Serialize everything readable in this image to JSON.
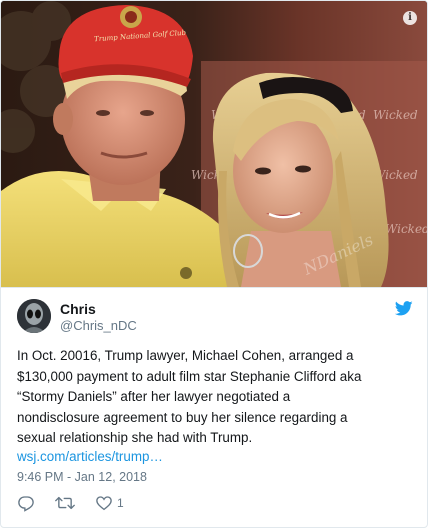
{
  "photo": {
    "info_icon": "info-icon",
    "hat_text": "Trump National Golf Club",
    "banner_text": "Wicked",
    "watermark_text": "NDaniels"
  },
  "author": {
    "display_name": "Chris",
    "handle": "@Chris_nDC",
    "avatar_icon": "alien-avatar"
  },
  "brand_icon": "twitter-bird-icon",
  "tweet": {
    "text": "In Oct. 20016, Trump lawyer, Michael Cohen, arranged a\n$130,000 payment to adult film star Stephanie Clifford aka\n“Stormy Daniels” after her lawyer negotiated a\nnondisclosure agreement to buy her silence regarding a\nsexual relationship she had with Trump.",
    "link": "wsj.com/articles/trump…",
    "timestamp": "9:46 PM - Jan 12, 2018"
  },
  "actions": {
    "reply_icon": "reply-icon",
    "retweet_icon": "retweet-icon",
    "like_icon": "heart-icon",
    "like_count": "1"
  },
  "colors": {
    "link": "#1b95e0",
    "muted": "#657786",
    "text": "#14171a",
    "border": "#e1e8ed",
    "twitter_blue": "#1da1f2"
  }
}
